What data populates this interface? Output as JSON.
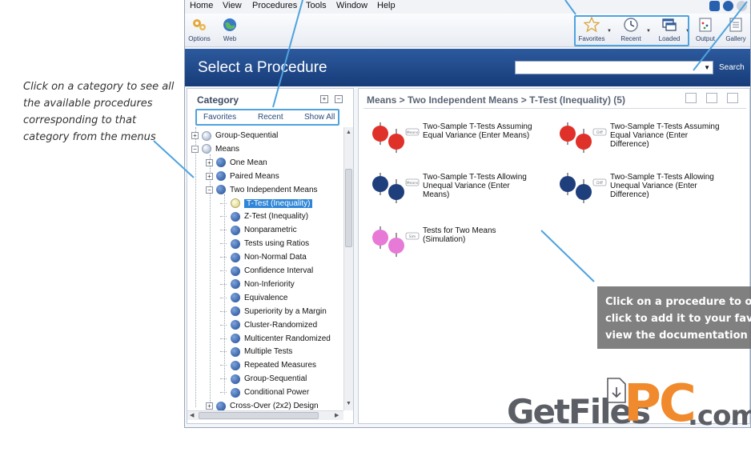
{
  "annotation_left": [
    "Click on a category to see all",
    "the available procedures",
    "corresponding to that",
    "category from the menus"
  ],
  "menubar": {
    "items": [
      "Home",
      "View",
      "Procedures",
      "Tools",
      "Window",
      "Help"
    ]
  },
  "toolbar": {
    "options": "Options",
    "web": "Web",
    "favorites": "Favorites",
    "recent": "Recent",
    "loaded": "Loaded",
    "output": "Output",
    "gallery": "Gallery"
  },
  "banner": {
    "title": "Select a Procedure",
    "search_label": "Search",
    "search_value": ""
  },
  "category": {
    "header": "Category",
    "expand_all": "+",
    "collapse_all": "−",
    "tabs": [
      "Favorites",
      "Recent",
      "Show All"
    ]
  },
  "tree": [
    {
      "label": "Group-Sequential",
      "ball": "gray",
      "expander": "+"
    },
    {
      "label": "Means",
      "ball": "gray",
      "expander": "−"
    },
    {
      "label": "One Mean",
      "ball": "blue",
      "expander": "+"
    },
    {
      "label": "Paired Means",
      "ball": "blue",
      "expander": "+"
    },
    {
      "label": "Two Independent Means",
      "ball": "blue",
      "expander": "−"
    },
    {
      "label": "T-Test (Inequality)",
      "ball": "yellow",
      "selected": true
    },
    {
      "label": "Z-Test (Inequality)",
      "ball": "blue"
    },
    {
      "label": "Nonparametric",
      "ball": "blue"
    },
    {
      "label": "Tests using Ratios",
      "ball": "blue"
    },
    {
      "label": "Non-Normal Data",
      "ball": "blue"
    },
    {
      "label": "Confidence Interval",
      "ball": "blue"
    },
    {
      "label": "Non-Inferiority",
      "ball": "blue"
    },
    {
      "label": "Equivalence",
      "ball": "blue"
    },
    {
      "label": "Superiority by a Margin",
      "ball": "blue"
    },
    {
      "label": "Cluster-Randomized",
      "ball": "blue"
    },
    {
      "label": "Multicenter Randomized",
      "ball": "blue"
    },
    {
      "label": "Multiple Tests",
      "ball": "blue"
    },
    {
      "label": "Repeated Measures",
      "ball": "blue"
    },
    {
      "label": "Group-Sequential",
      "ball": "blue"
    },
    {
      "label": "Conditional Power",
      "ball": "blue"
    },
    {
      "label": "Cross-Over (2x2) Design",
      "ball": "blue",
      "expander": "+"
    }
  ],
  "breadcrumb": "Means > Two Independent Means > T-Test (Inequality) (5)",
  "procedures": [
    {
      "lines": [
        "Two-Sample T-Tests Assuming",
        "Equal Variance (Enter Means)"
      ],
      "color": "#e0302a",
      "tag": "Means"
    },
    {
      "lines": [
        "Two-Sample T-Tests Assuming",
        "Equal Variance (Enter",
        "Difference)"
      ],
      "color": "#e0302a",
      "tag": "Diff"
    },
    {
      "lines": [
        "Two-Sample T-Tests Allowing",
        "Unequal Variance (Enter",
        "Means)"
      ],
      "color": "#1f3f7c",
      "tag": "Means"
    },
    {
      "lines": [
        "Two-Sample T-Tests Allowing",
        "Unequal Variance (Enter",
        "Difference)"
      ],
      "color": "#1f3f7c",
      "tag": "Diff"
    },
    {
      "lines": [
        "Tests for Two Means",
        "(Simulation)"
      ],
      "color": "#e67ad6",
      "tag": "Sim"
    }
  ],
  "tooltip": [
    "Click on a procedure to op",
    "click to add it to your favo",
    "view the documentation"
  ],
  "watermark": {
    "part1": "GetFiles",
    "part2": "PC",
    "part3": ".com"
  },
  "colors": {
    "callout_blue": "#4ea3de",
    "banner": "#1f4a8a",
    "watermark_orange": "#f08a2c"
  }
}
